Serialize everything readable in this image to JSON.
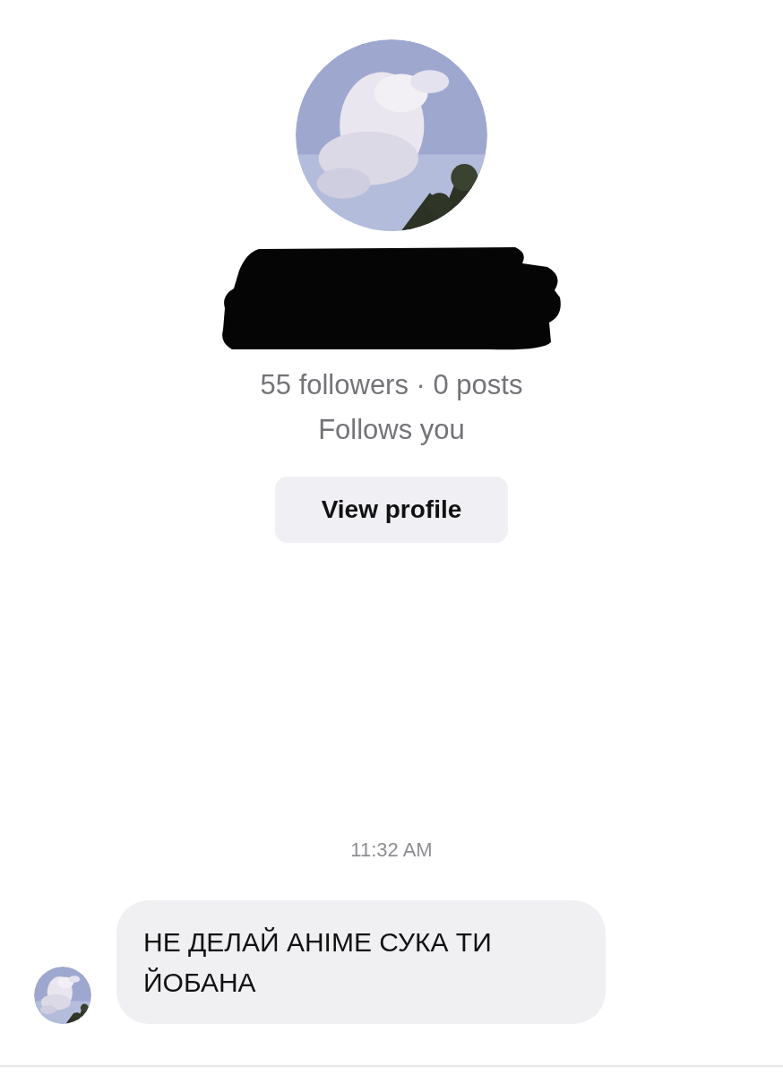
{
  "profile": {
    "stats": "55 followers · 0 posts",
    "relation": "Follows you",
    "button": "View profile"
  },
  "timestamp": "11:32 AM",
  "messages": [
    {
      "text": "НЕ ДЕЛАЙ АНІМЕ СУКА ТИ ЙОБАНА"
    }
  ]
}
